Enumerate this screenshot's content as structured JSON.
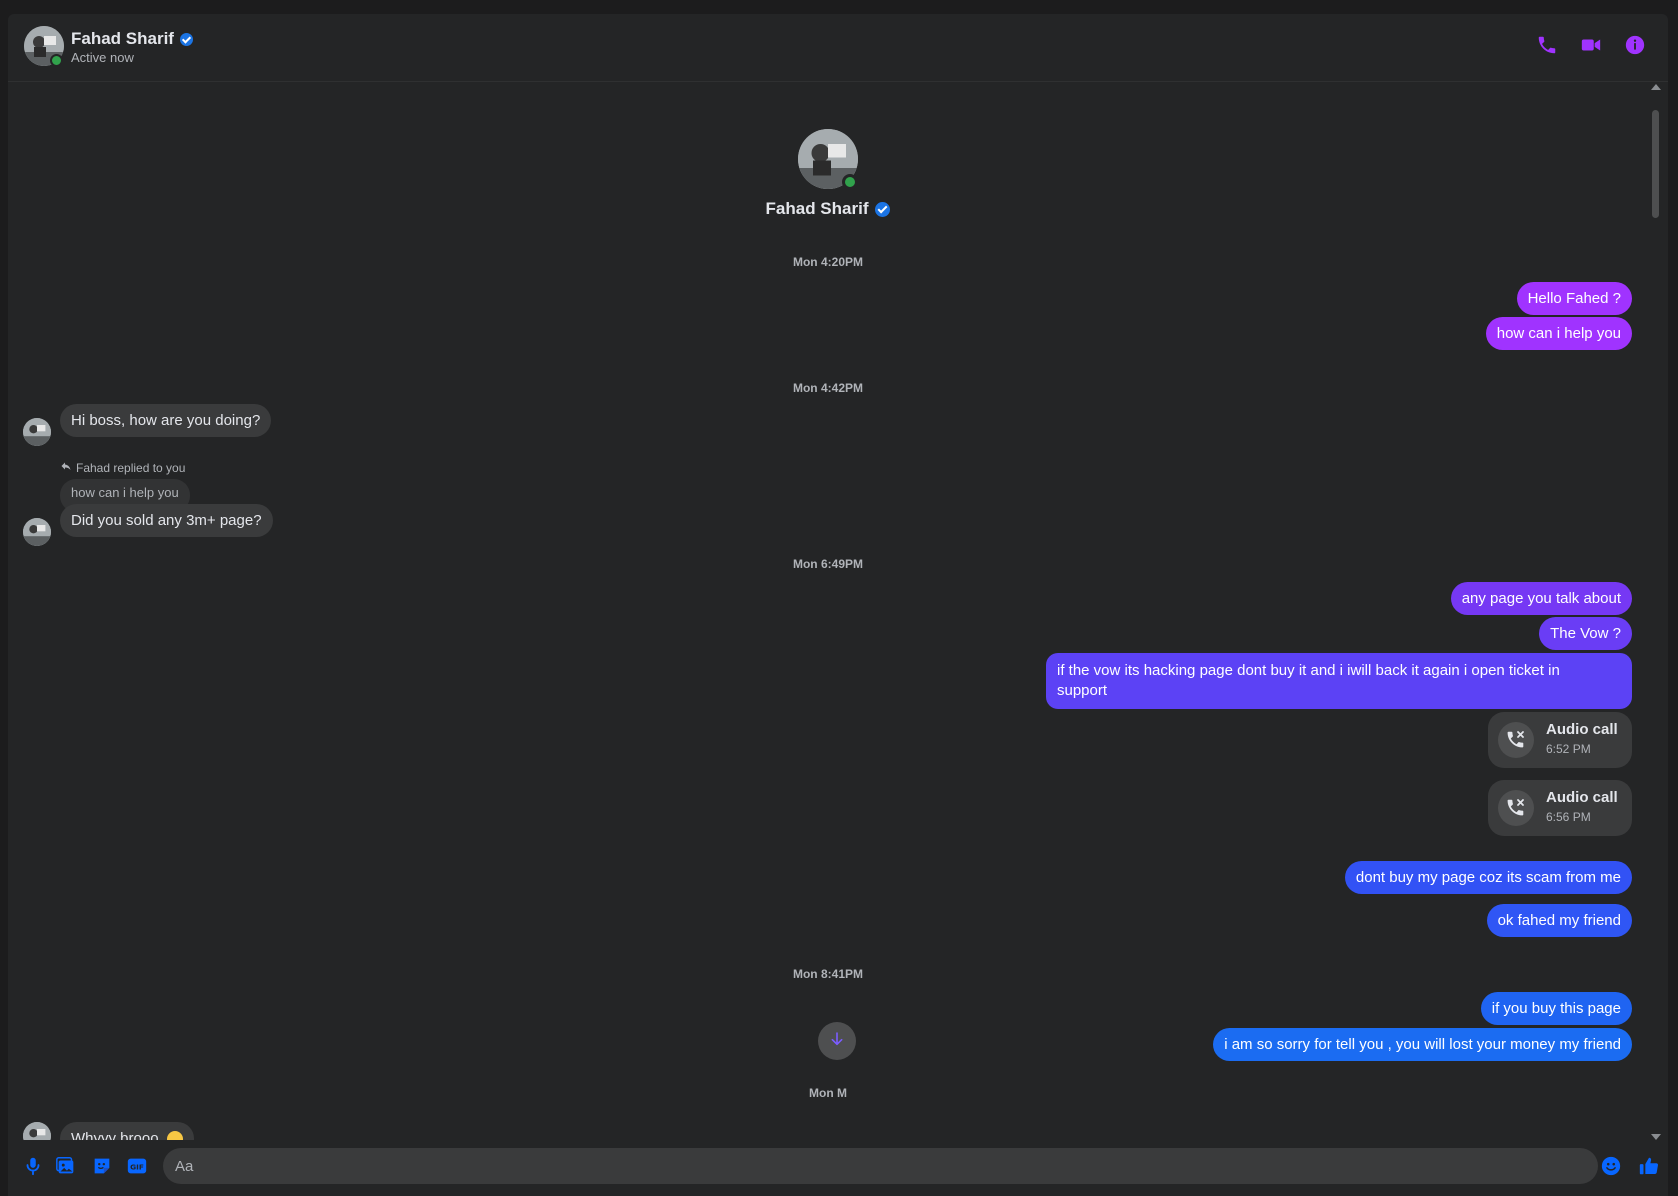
{
  "contact": {
    "name": "Fahad Sharif",
    "status": "Active now"
  },
  "colors": {
    "accent": "#a033ff",
    "blue": "#1b74e4",
    "online": "#31a24c"
  },
  "timestamps": [
    "Mon 4:20PM",
    "Mon 4:42PM",
    "Mon 6:49PM",
    "Mon 8:41PM",
    "Mon  M"
  ],
  "messages": {
    "out1": "Hello Fahed ?",
    "out2": "how can i help you",
    "in1": "Hi boss, how are you doing?",
    "reply_label": "Fahad replied to you",
    "reply_quote": "how can i help you",
    "in2": "Did you sold any 3m+ page?",
    "out3": "any page you talk about",
    "out4": "The Vow ?",
    "out5_line1": "if the vow its hacking page dont buy it and i iwill back it again i open ticket in",
    "out5_line2": "support",
    "call1_title": "Audio call",
    "call1_time": "6:52 PM",
    "call2_title": "Audio call",
    "call2_time": "6:56 PM",
    "out6": "dont buy my page coz its scam from me",
    "out7": "ok fahed my friend",
    "out8": "if you buy this page",
    "out9": "i am so sorry for tell you , you will lost your money my friend",
    "in3": "Whyyy brooo"
  },
  "composer": {
    "placeholder": "Aa"
  },
  "icons": [
    "phone-icon",
    "video-icon",
    "info-icon",
    "mic-icon",
    "image-icon",
    "sticker-icon",
    "gif-icon",
    "emoji-icon",
    "like-icon",
    "reply-arrow-icon",
    "missed-call-icon",
    "arrow-down-icon"
  ]
}
